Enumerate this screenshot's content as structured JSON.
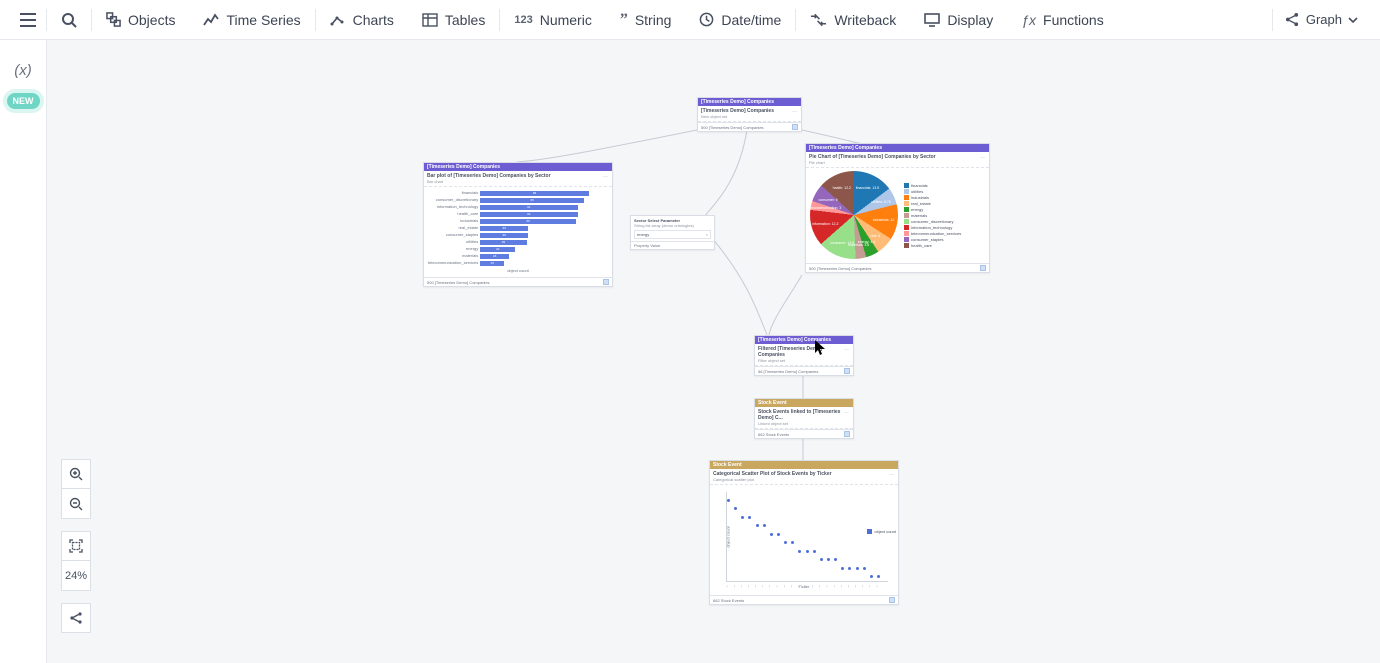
{
  "toolbar": {
    "items": [
      {
        "id": "objects",
        "label": "Objects"
      },
      {
        "id": "timeseries",
        "label": "Time Series"
      },
      {
        "id": "charts",
        "label": "Charts"
      },
      {
        "id": "tables",
        "label": "Tables"
      },
      {
        "id": "numeric",
        "label": "Numeric"
      },
      {
        "id": "string",
        "label": "String"
      },
      {
        "id": "datetime",
        "label": "Date/time"
      },
      {
        "id": "writeback",
        "label": "Writeback"
      },
      {
        "id": "display",
        "label": "Display"
      },
      {
        "id": "functions",
        "label": "Functions"
      }
    ],
    "view_mode": "Graph"
  },
  "leftbar": {
    "new_label": "NEW"
  },
  "zoom": {
    "percent": "24%"
  },
  "node_top": {
    "hdr": "[Timeseries Demo] Companies",
    "title": "[Timeseries Demo] Companies",
    "sub": "New object set",
    "footer": "500 [Timeseries Demo] Companies"
  },
  "param_node": {
    "title": "Sector Select Parameter",
    "sub": "String list array (demo ontologies)",
    "field_label": "energy",
    "pfoot": "Property Value"
  },
  "bar_node": {
    "hdr": "[Timeseries Demo] Companies",
    "title": "Bar plot of [Timeseries Demo] Companies by Sector",
    "sub": "Bar chart",
    "xlabel": "object count",
    "footer": "500 [Timeseries Demo] Companies"
  },
  "pie_node": {
    "hdr": "[Timeseries Demo] Companies",
    "title": "Pie Chart of [Timeseries Demo] Companies by Sector",
    "sub": "Pie chart",
    "footer": "500 [Timeseries Demo] Companies"
  },
  "filter_node": {
    "hdr": "[Timeseries Demo] Companies",
    "title": "Filtered [Timeseries Demo] Companies",
    "sub": "Filter object set",
    "footer": "56 [Timeseries Demo] Companies"
  },
  "link_node": {
    "hdr": "Stock Event",
    "title": "Stock Events linked to [Timeseries Demo] C...",
    "sub": "Linked object set",
    "footer": "662 Stock Events"
  },
  "scatter_node": {
    "hdr": "Stock Event",
    "title": "Categorical Scatter Plot of Stock Events by Ticker",
    "sub": "Categorical scatter plot",
    "xlabel": "Ticker",
    "ylabel": "object count",
    "legend": "object count",
    "footer": "662 Stock Events"
  },
  "chart_data": [
    {
      "type": "bar",
      "orientation": "horizontal",
      "title": "Bar plot of [Timeseries Demo] Companies by Sector",
      "xlabel": "object count",
      "ylabel": "",
      "xlim": [
        0,
        80
      ],
      "categories": [
        "financials",
        "consumer_discretionary",
        "information_technology",
        "health_care",
        "industrials",
        "real_estate",
        "consumer_staples",
        "utilities",
        "energy",
        "materials",
        "telecommunication_services"
      ],
      "values": [
        68,
        65,
        61,
        61,
        60,
        30,
        30,
        29,
        22,
        18,
        15
      ]
    },
    {
      "type": "pie",
      "title": "Pie Chart of [Timeseries Demo] Companies by Sector",
      "series": [
        {
          "name": "financials",
          "value": 13.5,
          "color": "#1f77b4"
        },
        {
          "name": "utilities",
          "value": 5.76,
          "color": "#aec7e8"
        },
        {
          "name": "industrials",
          "value": 12.0,
          "color": "#ff7f0e"
        },
        {
          "name": "real_estate",
          "value": 6.0,
          "color": "#ffbb78"
        },
        {
          "name": "energy",
          "value": 4.4,
          "color": "#2ca02c"
        },
        {
          "name": "materials",
          "value": 3.6,
          "color": "#c49c94"
        },
        {
          "name": "consumer_discretionary",
          "value": 12.9,
          "color": "#98df8a"
        },
        {
          "name": "information_technology",
          "value": 12.2,
          "color": "#d62728"
        },
        {
          "name": "telecommunication_services",
          "value": 3.0,
          "color": "#ff9896"
        },
        {
          "name": "consumer_staples",
          "value": 6.0,
          "color": "#9467bd"
        },
        {
          "name": "health_care",
          "value": 12.2,
          "color": "#8c564b"
        }
      ]
    },
    {
      "type": "scatter",
      "title": "Categorical Scatter Plot of Stock Events by Ticker",
      "xlabel": "Ticker",
      "ylabel": "object count",
      "x": [
        0,
        1,
        2,
        3,
        4,
        5,
        6,
        7,
        8,
        9,
        10,
        11,
        12,
        13,
        14,
        15,
        16,
        17,
        18,
        19,
        20,
        21
      ],
      "y": [
        18,
        17,
        16,
        16,
        15,
        15,
        14,
        14,
        13,
        13,
        12,
        12,
        12,
        11,
        11,
        11,
        10,
        10,
        10,
        10,
        9,
        9
      ]
    }
  ]
}
